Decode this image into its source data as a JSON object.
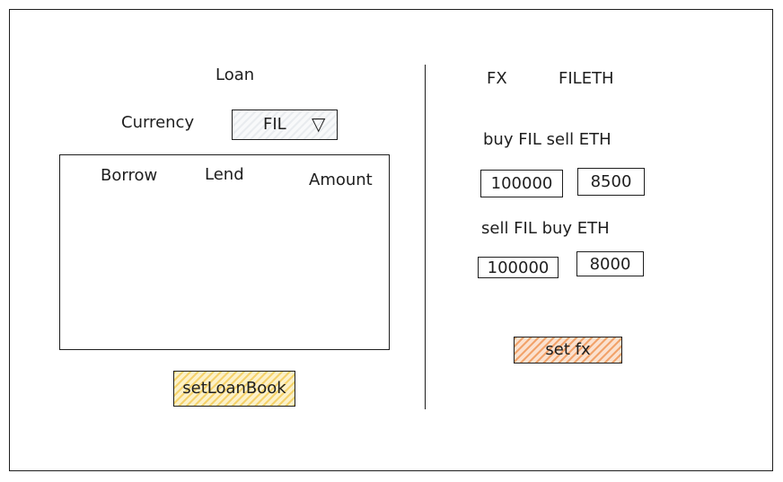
{
  "loan": {
    "title": "Loan",
    "currency_label": "Currency",
    "currency_value": "FIL",
    "dropdown_glyph": "▽",
    "table_headers": [
      "Borrow",
      "Lend",
      "Amount"
    ],
    "submit_label": "setLoanBook",
    "submit_color": "#f5d26b"
  },
  "fx": {
    "title": "FX",
    "pair": "FILETH",
    "buy_label": "buy FIL sell ETH",
    "buy_amount": "100000",
    "buy_rate": "8500",
    "sell_label": "sell FIL buy ETH",
    "sell_amount": "100000",
    "sell_rate": "8000",
    "submit_label": "set fx",
    "submit_color": "#f2a36b"
  }
}
